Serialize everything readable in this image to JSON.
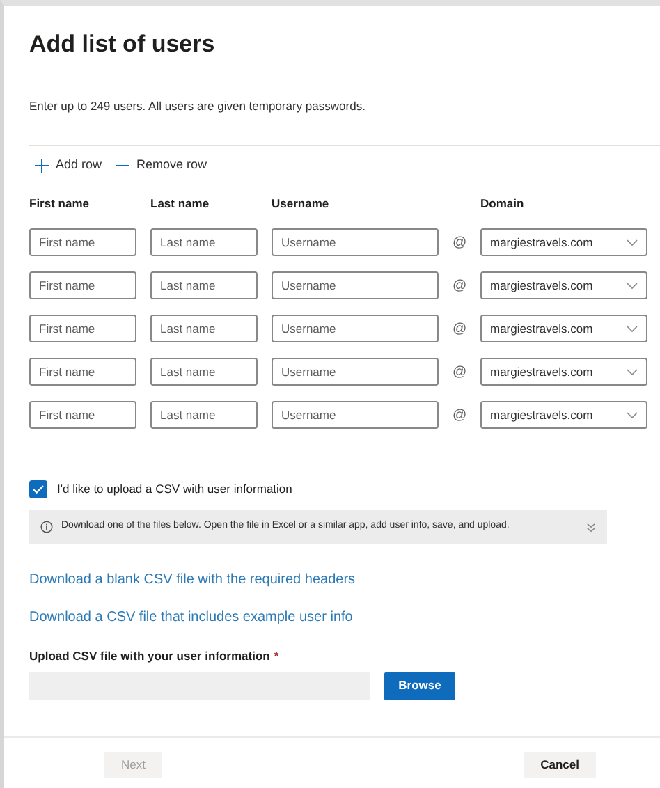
{
  "title": "Add list of users",
  "description": "Enter up to 249 users. All users are given temporary passwords.",
  "toolbar": [
    {
      "kind": "add",
      "label": "Add row"
    },
    {
      "kind": "remove",
      "label": "Remove row"
    }
  ],
  "columns": [
    "First name",
    "Last name",
    "Username",
    "Domain"
  ],
  "rows": [
    {
      "first_name": {
        "placeholder": "First name"
      },
      "last_name": {
        "placeholder": "Last name"
      },
      "username": {
        "placeholder": "Username"
      },
      "separator": "@",
      "domain": "margiestravels.com"
    },
    {
      "first_name": {
        "placeholder": "First name"
      },
      "last_name": {
        "placeholder": "Last name"
      },
      "username": {
        "placeholder": "Username"
      },
      "separator": "@",
      "domain": "margiestravels.com"
    },
    {
      "first_name": {
        "placeholder": "First name"
      },
      "last_name": {
        "placeholder": "Last name"
      },
      "username": {
        "placeholder": "Username"
      },
      "separator": "@",
      "domain": "margiestravels.com"
    },
    {
      "first_name": {
        "placeholder": "First name"
      },
      "last_name": {
        "placeholder": "Last name"
      },
      "username": {
        "placeholder": "Username"
      },
      "separator": "@",
      "domain": "margiestravels.com"
    },
    {
      "first_name": {
        "placeholder": "First name"
      },
      "last_name": {
        "placeholder": "Last name"
      },
      "username": {
        "placeholder": "Username"
      },
      "separator": "@",
      "domain": "margiestravels.com"
    }
  ],
  "csv_option": {
    "label": "I'd like to upload a CSV with user information",
    "checked": true
  },
  "info": {
    "text": "Download one of the files below. Open the file in Excel or a similar app, add user info, save, and upload."
  },
  "links": [
    "Download a blank CSV file with the required headers",
    "Download a CSV file that includes example user info"
  ],
  "upload": {
    "label": "Upload CSV file with your user information",
    "required_mark": "*",
    "button": "Browse"
  },
  "footer": [
    {
      "label": "Next",
      "disabled": true
    },
    {
      "label": "Cancel",
      "disabled": false
    }
  ]
}
